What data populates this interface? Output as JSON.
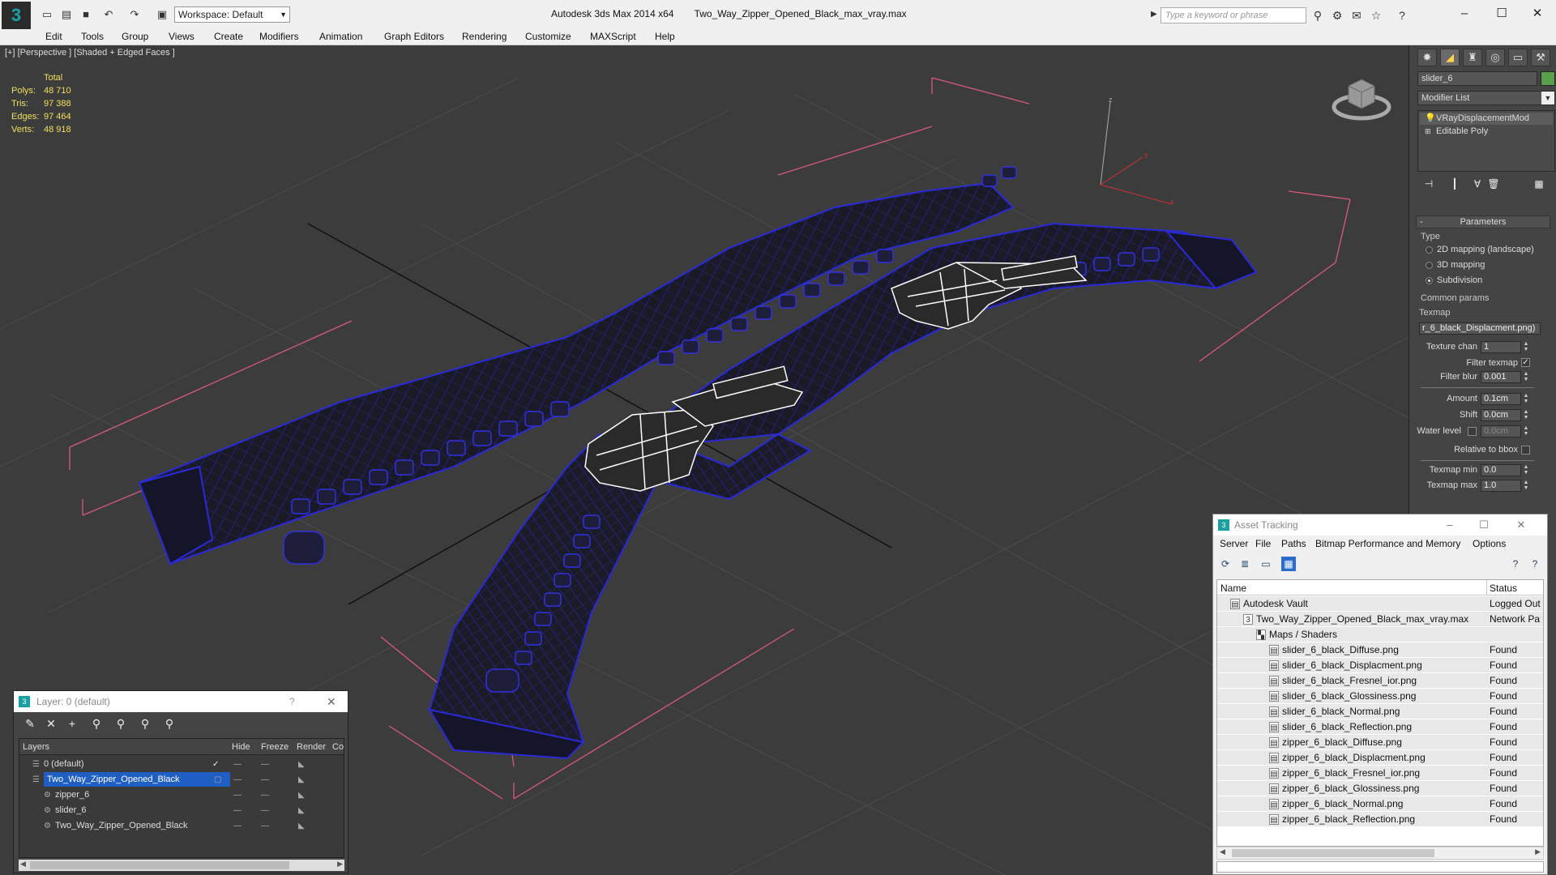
{
  "titlebar": {
    "app_name": "Autodesk 3ds Max  2014 x64",
    "file_name": "Two_Way_Zipper_Opened_Black_max_vray.max",
    "workspace": "Workspace: Default",
    "search_placeholder": "Type a keyword or phrase"
  },
  "menu": [
    "Edit",
    "Tools",
    "Group",
    "Views",
    "Create",
    "Modifiers",
    "Animation",
    "Graph Editors",
    "Rendering",
    "Customize",
    "MAXScript",
    "Help"
  ],
  "viewport": {
    "label": "[+] [Perspective ] [Shaded + Edged Faces ]",
    "stats": {
      "header": "Total",
      "rows": [
        {
          "k": "Polys:",
          "v": "48 710"
        },
        {
          "k": "Tris:",
          "v": "97 388"
        },
        {
          "k": "Edges:",
          "v": "97 464"
        },
        {
          "k": "Verts:",
          "v": "48 918"
        }
      ]
    },
    "axis_z": "z",
    "axis_y": "y",
    "axis_x": "x"
  },
  "command_panel": {
    "object_name": "slider_6",
    "modifier_list": "Modifier List",
    "stack": [
      "VRayDisplacementMod",
      "Editable Poly"
    ],
    "parameters": {
      "header": "Parameters",
      "type_label": "Type",
      "types": [
        {
          "label": "2D mapping (landscape)",
          "on": false
        },
        {
          "label": "3D mapping",
          "on": false
        },
        {
          "label": "Subdivision",
          "on": true
        }
      ],
      "common_label": "Common params",
      "texmap_label": "Texmap",
      "texmap_value": "r_6_black_Displacment.png)",
      "texture_chan_label": "Texture chan",
      "texture_chan_value": "1",
      "filter_texmap_label": "Filter texmap",
      "filter_blur_label": "Filter blur",
      "filter_blur_value": "0.001",
      "amount_label": "Amount",
      "amount_value": "0.1cm",
      "shift_label": "Shift",
      "shift_value": "0.0cm",
      "water_label": "Water level",
      "water_value": "0.0cm",
      "relbbox_label": "Relative to bbox",
      "texmin_label": "Texmap min",
      "texmin_value": "0.0",
      "texmax_label": "Texmap max",
      "texmax_value": "1.0"
    }
  },
  "asset_tracking": {
    "title": "Asset Tracking",
    "menu": [
      "Server",
      "File",
      "Paths",
      "Bitmap Performance and Memory",
      "Options"
    ],
    "col_name": "Name",
    "col_status": "Status",
    "rows": [
      {
        "name": "Autodesk Vault",
        "status": "Logged Out",
        "indent": 0
      },
      {
        "name": "Two_Way_Zipper_Opened_Black_max_vray.max",
        "status": "Network Pa",
        "indent": 1
      },
      {
        "name": "Maps / Shaders",
        "status": "",
        "indent": 2
      },
      {
        "name": "slider_6_black_Diffuse.png",
        "status": "Found",
        "indent": 3
      },
      {
        "name": "slider_6_black_Displacment.png",
        "status": "Found",
        "indent": 3
      },
      {
        "name": "slider_6_black_Fresnel_ior.png",
        "status": "Found",
        "indent": 3
      },
      {
        "name": "slider_6_black_Glossiness.png",
        "status": "Found",
        "indent": 3
      },
      {
        "name": "slider_6_black_Normal.png",
        "status": "Found",
        "indent": 3
      },
      {
        "name": "slider_6_black_Reflection.png",
        "status": "Found",
        "indent": 3
      },
      {
        "name": "zipper_6_black_Diffuse.png",
        "status": "Found",
        "indent": 3
      },
      {
        "name": "zipper_6_black_Displacment.png",
        "status": "Found",
        "indent": 3
      },
      {
        "name": "zipper_6_black_Fresnel_ior.png",
        "status": "Found",
        "indent": 3
      },
      {
        "name": "zipper_6_black_Glossiness.png",
        "status": "Found",
        "indent": 3
      },
      {
        "name": "zipper_6_black_Normal.png",
        "status": "Found",
        "indent": 3
      },
      {
        "name": "zipper_6_black_Reflection.png",
        "status": "Found",
        "indent": 3
      }
    ]
  },
  "layer_window": {
    "title": "Layer: 0 (default)",
    "help": "?",
    "cols": {
      "layers": "Layers",
      "hide": "Hide",
      "freeze": "Freeze",
      "render": "Render",
      "color": "Co"
    },
    "rows": [
      {
        "name": "0 (default)",
        "indent": 1,
        "selected": false,
        "current": true
      },
      {
        "name": "Two_Way_Zipper_Opened_Black",
        "indent": 1,
        "selected": true,
        "current": false
      },
      {
        "name": "zipper_6",
        "indent": 2,
        "selected": false,
        "current": false
      },
      {
        "name": "slider_6",
        "indent": 2,
        "selected": false,
        "current": false
      },
      {
        "name": "Two_Way_Zipper_Opened_Black",
        "indent": 2,
        "selected": false,
        "current": false
      }
    ]
  },
  "colors": {
    "wire_blue": "#2a2ad8",
    "slider_white": "#ffffff",
    "bbox_pink": "#d85a7a",
    "stats_yellow": "#f0e060",
    "selection_blue": "#1f5fc4"
  }
}
